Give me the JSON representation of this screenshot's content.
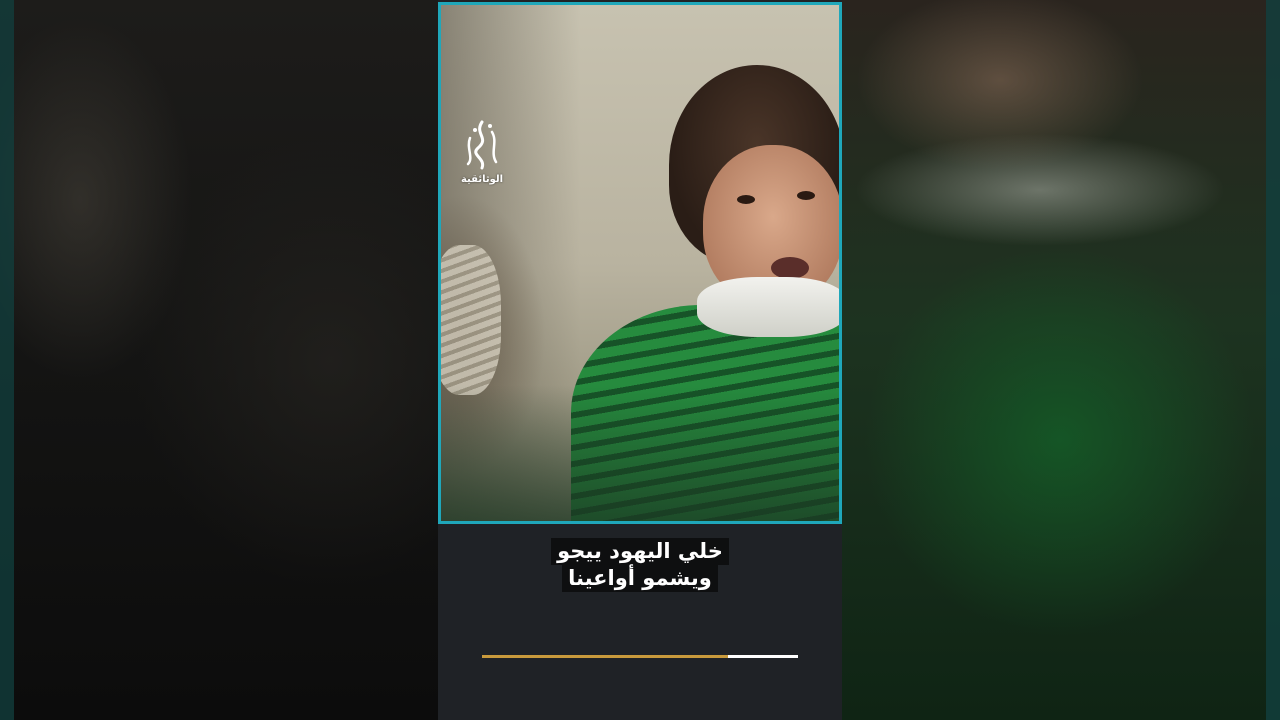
{
  "video": {
    "title": "",
    "logo": {
      "name": "aljazeera-documentary-logo",
      "caption": "الوثائقية"
    },
    "subtitles": {
      "line1": "خلي اليهود ييجو",
      "line2": "ويشمو أواعينا"
    },
    "progress": {
      "fraction": 0.78,
      "played_color": "#c89a3c",
      "remaining_color": "#ffffff"
    },
    "frame_border_color": "#1fa7ba"
  }
}
